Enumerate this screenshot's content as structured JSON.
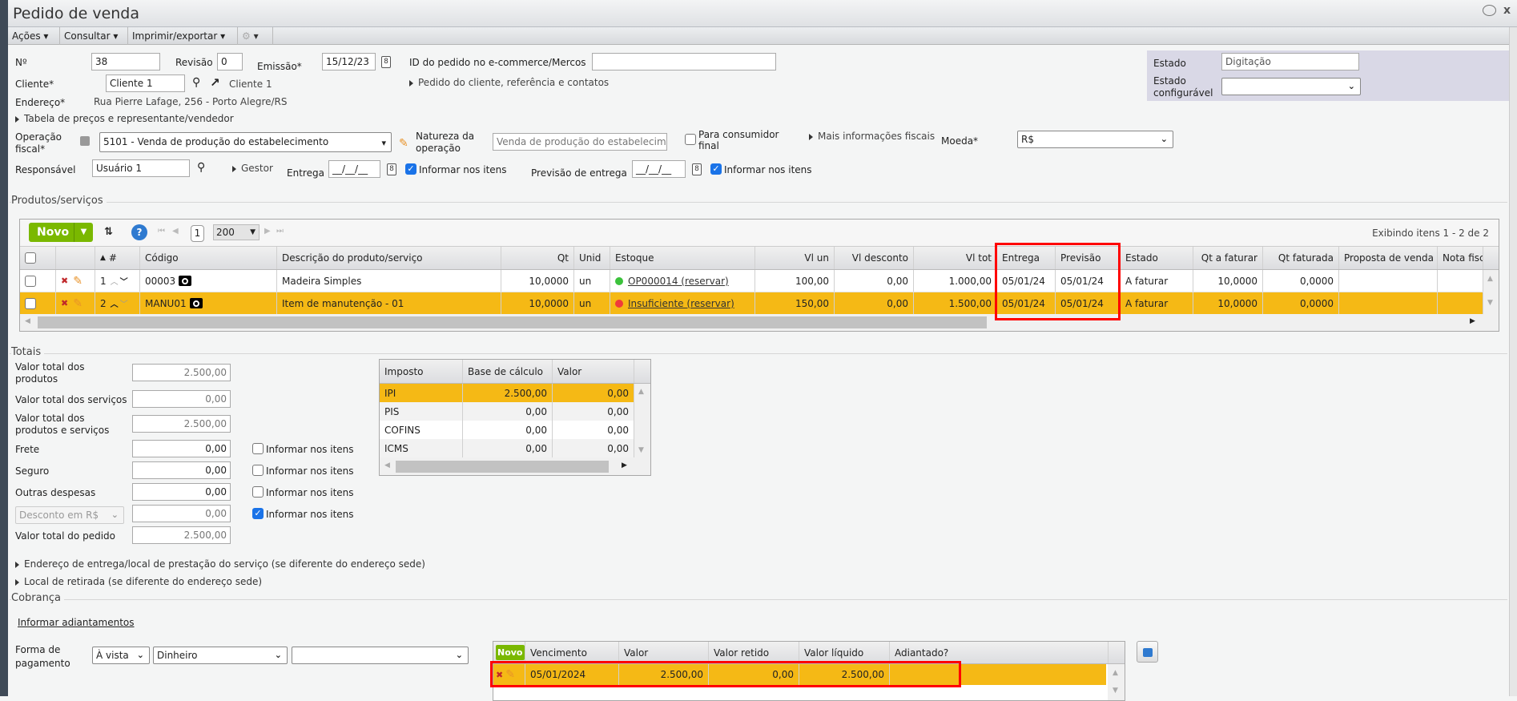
{
  "window": {
    "title": "Pedido de venda"
  },
  "toolbar": {
    "acoes": "Ações",
    "consultar": "Consultar",
    "imprimir": "Imprimir/exportar"
  },
  "header": {
    "numero_label": "Nº",
    "numero": "38",
    "revisao_label": "Revisão",
    "revisao": "0",
    "emissao_label": "Emissão*",
    "emissao": "15/12/23",
    "ecommerce_label": "ID do pedido no e-commerce/Mercos",
    "ecommerce": "",
    "cliente_label": "Cliente*",
    "cliente": "Cliente 1",
    "cliente_link": "Cliente 1",
    "pedido_cliente": "Pedido do cliente, referência e contatos",
    "endereco_label": "Endereço*",
    "endereco": "Rua Pierre Lafage, 256 - Porto Alegre/RS",
    "tabela_precos": "Tabela de preços e representante/vendedor",
    "operacao_label1": "Operação",
    "operacao_label2": "fiscal*",
    "operacao": "5101 - Venda de produção do estabelecimento",
    "natureza_label1": "Natureza da",
    "natureza_label2": "operação",
    "natureza": "Venda de produção do estabelecimento",
    "consumidor_label1": "Para consumidor",
    "consumidor_label2": "final",
    "consumidor_checked": false,
    "mais_fiscais": "Mais informações fiscais",
    "moeda_label": "Moeda*",
    "moeda": "R$",
    "responsavel_label": "Responsável",
    "responsavel": "Usuário 1",
    "gestor": "Gestor",
    "entrega_label": "Entrega",
    "entrega": "__/__/__",
    "entrega_itens": "Informar nos itens",
    "entrega_itens_checked": true,
    "previsao_label": "Previsão de entrega",
    "previsao": "__/__/__",
    "previsao_itens": "Informar nos itens",
    "previsao_itens_checked": true,
    "estado_label": "Estado",
    "estado": "Digitação",
    "estado_conf_label1": "Estado",
    "estado_conf_label2": "configurável",
    "estado_conf": ""
  },
  "produtos": {
    "section": "Produtos/serviços",
    "novo": "Novo",
    "page": "1",
    "page_size": "200",
    "exibindo": "Exibindo itens 1 - 2 de 2",
    "columns": [
      "",
      "",
      "#",
      "Código",
      "Descrição do produto/serviço",
      "Qt",
      "Unid",
      "Estoque",
      "Vl un",
      "Vl desconto",
      "Vl tot",
      "Entrega",
      "Previsão",
      "Estado",
      "Qt a faturar",
      "Qt faturada",
      "Proposta de venda",
      "Nota fiscal"
    ],
    "rows": [
      {
        "n": "1",
        "codigo": "00003",
        "descricao": "Madeira Simples",
        "qt": "10,0000",
        "unid": "un",
        "estoque": "OP000014 (reservar)",
        "estoque_status": "#3cc23c",
        "vl_un": "100,00",
        "vl_desc": "0,00",
        "vl_tot": "1.000,00",
        "entrega": "05/01/24",
        "previsao": "05/01/24",
        "estado": "A faturar",
        "qt_faturar": "10,0000",
        "qt_faturada": "0,0000",
        "proposta": "",
        "nota": "",
        "selected": false
      },
      {
        "n": "2",
        "codigo": "MANU01",
        "descricao": "Item de manutenção - 01",
        "qt": "10,0000",
        "unid": "un",
        "estoque": "Insuficiente (reservar)",
        "estoque_status": "#f03a3a",
        "vl_un": "150,00",
        "vl_desc": "0,00",
        "vl_tot": "1.500,00",
        "entrega": "05/01/24",
        "previsao": "05/01/24",
        "estado": "A faturar",
        "qt_faturar": "10,0000",
        "qt_faturada": "0,0000",
        "proposta": "",
        "nota": "",
        "selected": true
      }
    ]
  },
  "totais": {
    "section": "Totais",
    "fields": [
      {
        "label": "Valor total dos produtos",
        "value": "2.500,00"
      },
      {
        "label": "Valor total dos serviços",
        "value": "0,00"
      },
      {
        "label": "Valor total dos produtos e serviços",
        "value": "2.500,00"
      },
      {
        "label": "Frete",
        "value": "0,00",
        "check": "Informar nos itens",
        "checked": false
      },
      {
        "label": "Seguro",
        "value": "0,00",
        "check": "Informar nos itens",
        "checked": false
      },
      {
        "label": "Outras despesas",
        "value": "0,00",
        "check": "Informar nos itens",
        "checked": false
      },
      {
        "label": "Desconto em R$",
        "value": "0,00",
        "check": "Informar nos itens",
        "checked": true
      },
      {
        "label": "Valor total do pedido",
        "value": "2.500,00"
      }
    ],
    "impostos_columns": [
      "Imposto",
      "Base de cálculo",
      "Valor"
    ],
    "impostos": [
      {
        "imposto": "IPI",
        "base": "2.500,00",
        "valor": "0,00"
      },
      {
        "imposto": "PIS",
        "base": "0,00",
        "valor": "0,00"
      },
      {
        "imposto": "COFINS",
        "base": "0,00",
        "valor": "0,00"
      },
      {
        "imposto": "ICMS",
        "base": "0,00",
        "valor": "0,00"
      }
    ]
  },
  "links": {
    "endereco_entrega": "Endereço de entrega/local de prestação do serviço (se diferente do endereço sede)",
    "local_retirada": "Local de retirada (se diferente do endereço sede)"
  },
  "cobranca": {
    "section": "Cobrança",
    "adiantamentos": "Informar adiantamentos",
    "forma_label1": "Forma de",
    "forma_label2": "pagamento",
    "condicao": "À vista",
    "meio": "Dinheiro",
    "extra": "",
    "novo": "Novo",
    "columns": [
      "Vencimento",
      "Valor",
      "Valor retido",
      "Valor líquido",
      "Adiantado?"
    ],
    "rows": [
      {
        "vencimento": "05/01/2024",
        "valor": "2.500,00",
        "retido": "0,00",
        "liquido": "2.500,00",
        "adiantado": ""
      }
    ]
  },
  "colors": {
    "selected_row": "#f5b915",
    "novo_button": "#7ab800",
    "highlight_box": "#ff0000",
    "estado_panel": "#d9d8e6"
  }
}
